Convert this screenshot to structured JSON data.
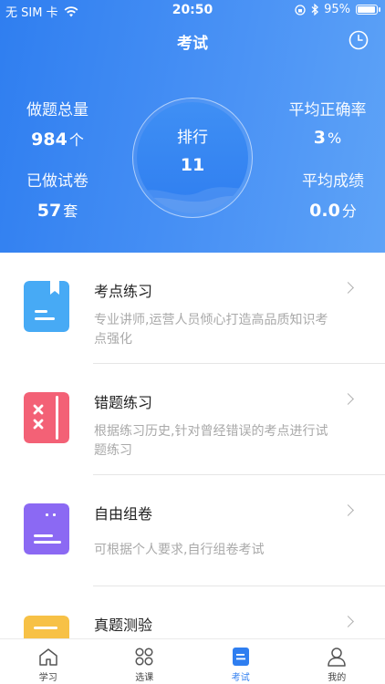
{
  "status_bar": {
    "carrier": "无 SIM 卡",
    "time": "20:50",
    "battery": "95%"
  },
  "header": {
    "title": "考试",
    "history_icon": "clock-icon"
  },
  "stats": {
    "total_questions": {
      "label": "做题总量",
      "value": "984",
      "unit": "个"
    },
    "papers_done": {
      "label": "已做试卷",
      "value": "57",
      "unit": "套"
    },
    "accuracy": {
      "label": "平均正确率",
      "value": "3",
      "unit": "%"
    },
    "avg_score": {
      "label": "平均成绩",
      "value": "0.0",
      "unit": "分"
    }
  },
  "rank": {
    "label": "排行",
    "value": "11"
  },
  "items": [
    {
      "title": "考点练习",
      "desc": "专业讲师,运营人员倾心打造高品质知识考点强化",
      "icon": "bookmark-book-icon",
      "color": "#47aaf5"
    },
    {
      "title": "错题练习",
      "desc": "根据练习历史,针对曾经错误的考点进行试题练习",
      "icon": "wrong-notebook-icon",
      "color": "#f36176"
    },
    {
      "title": "自由组卷",
      "desc": "可根据个人要求,自行组卷考试",
      "icon": "custom-paper-icon",
      "color": "#8b69f3"
    },
    {
      "title": "真题测验",
      "desc": "",
      "icon": "real-exam-icon",
      "color": "#f7c146"
    }
  ],
  "tabs": [
    {
      "label": "学习",
      "icon": "home-icon",
      "active": false
    },
    {
      "label": "选课",
      "icon": "grid-icon",
      "active": false
    },
    {
      "label": "考试",
      "icon": "exam-icon",
      "active": true
    },
    {
      "label": "我的",
      "icon": "person-icon",
      "active": false
    }
  ],
  "colors": {
    "primary": "#2f7ef0",
    "header_end": "#5ea3f7",
    "text_dark": "#222222",
    "text_muted": "#a9a9a9"
  }
}
